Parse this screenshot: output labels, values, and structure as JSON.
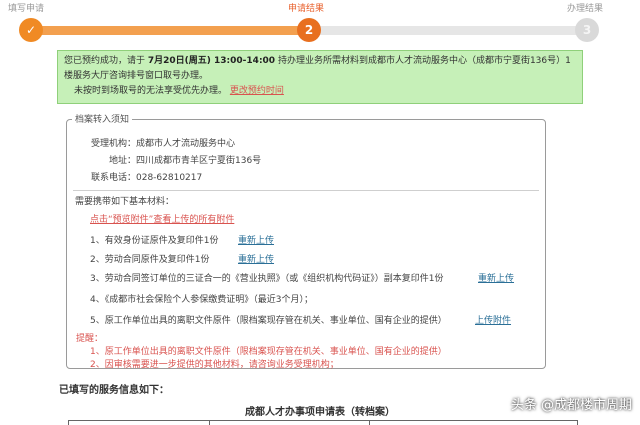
{
  "steps": {
    "step1": "填写申请",
    "step2": "申请结果",
    "step3": "办理结果",
    "step1_mark": "✓",
    "step2_num": "2",
    "step3_num": "3",
    "colors": {
      "done": "#f08a24",
      "current": "#e86f1f",
      "pending": "#d9d9d9"
    }
  },
  "notice": {
    "part1": "您已预约成功，请于",
    "datetime": "7月20日(周五) 13:00-14:00",
    "part2": "持办理业务所需材料到成都市人才流动服务中心（成都市宁夏街136号）1楼服务大厅咨询排号窗口取号办理。",
    "late_text": "未按时到场取号的无法享受优先办理。",
    "change_link": "更改预约时间"
  },
  "archive": {
    "legend": "档案转入须知",
    "agency_label": "受理机构：",
    "agency": "成都市人才流动服务中心",
    "address_label": "地址：",
    "address": "四川成都市青羊区宁夏街136号",
    "phone_label": "联系电话：",
    "phone": "028-62810217",
    "materials_title": "需要携带如下基本材料：",
    "view_tip": "点击“预览附件”查看上传的所有附件",
    "items": [
      "1、有效身份证原件及复印件1份",
      "2、劳动合同原件及复印件1份",
      "3、劳动合同签订单位的三证合一的《营业执照》（或《组织机构代码证》）副本复印件1份",
      "4、《成都市社会保险个人参保缴费证明》（最近3个月）；",
      "5、原工作单位出具的离职文件原件（限档案现存管在机关、事业单位、国有企业的提供）"
    ],
    "upload_label": "重新上传",
    "upload_label_b": "上传附件",
    "reminder_title": "提醒：",
    "reminders": [
      "1、原工作单位出具的离职文件原件（限档案现存管在机关、事业单位、国有企业的提供）",
      "2、因审核需要进一步提供的其他材料，请咨询业务受理机构；"
    ]
  },
  "filled": {
    "heading": "已填写的服务信息如下：",
    "form_title": "成都人才办事项申请表（转档案）"
  },
  "watermark": "头条 @成都楼市周期"
}
